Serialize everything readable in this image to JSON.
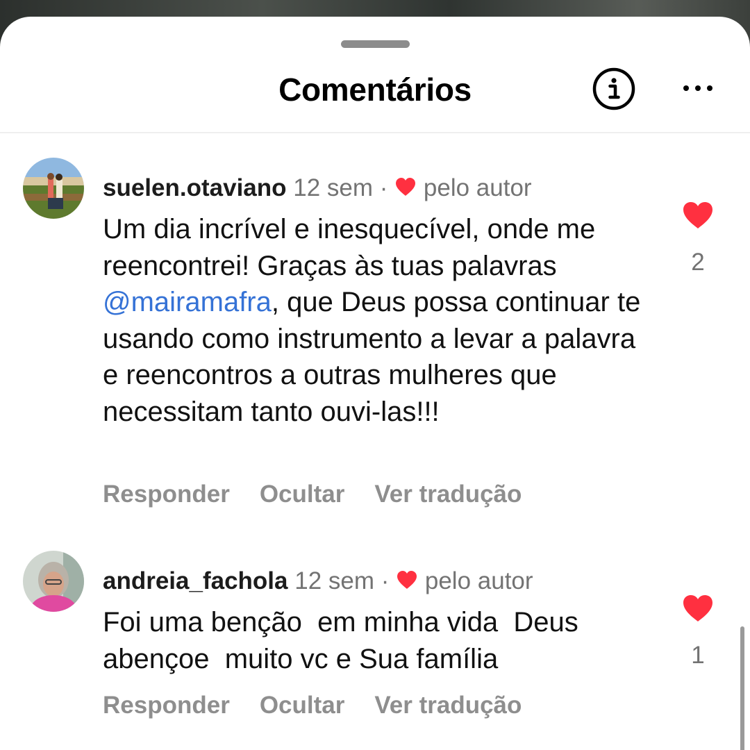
{
  "header": {
    "title": "Comentários",
    "info_icon": "info-circle-icon",
    "more_icon": "more-horizontal-icon"
  },
  "colors": {
    "heart": "#ff3040",
    "mention": "#3572d6",
    "muted": "#737373"
  },
  "comments": [
    {
      "username": "suelen.otaviano",
      "time": "12 sem",
      "separator": "·",
      "liked_by_author": "pelo autor",
      "text_before": "Um dia incrível e inesquecível, onde me reencontrei! Graças às tuas palavras ",
      "mention": "@mairamafra",
      "text_after": ", que Deus possa continuar te usando como instrumento a levar a palavra e reencontros a outras mulheres que necessitam tanto ouvi-las!!!",
      "actions": {
        "reply": "Responder",
        "hide": "Ocultar",
        "translate": "Ver tradução"
      },
      "likes": "2",
      "liked": true
    },
    {
      "username": "andreia_fachola",
      "time": "12 sem",
      "separator": "·",
      "liked_by_author": "pelo autor",
      "text": "Foi uma benção  em minha vida  Deus abençoe  muito vc e Sua família",
      "actions": {
        "reply": "Responder",
        "hide": "Ocultar",
        "translate": "Ver tradução"
      },
      "likes": "1",
      "liked": true
    }
  ]
}
